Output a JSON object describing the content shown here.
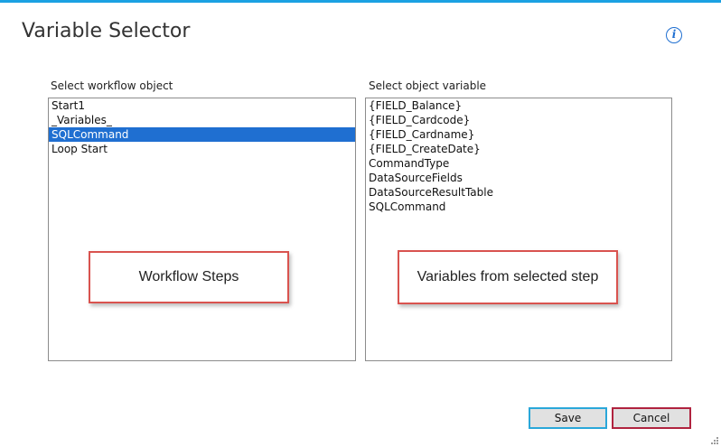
{
  "dialog": {
    "title": "Variable Selector",
    "info_icon": "info-icon",
    "accent_color": "#1ba1e2"
  },
  "left_panel": {
    "label": "Select workflow object",
    "items": [
      "Start1",
      "_Variables_",
      "SQLCommand",
      "Loop Start"
    ],
    "selected": "SQLCommand",
    "callout": "Workflow Steps"
  },
  "right_panel": {
    "label": "Select object variable",
    "items": [
      "{FIELD_Balance}",
      "{FIELD_Cardcode}",
      "{FIELD_Cardname}",
      "{FIELD_CreateDate}",
      "CommandType",
      "DataSourceFields",
      "DataSourceResultTable",
      "SQLCommand"
    ],
    "callout": "Variables from selected step"
  },
  "buttons": {
    "save_label": "Save",
    "cancel_label": "Cancel"
  },
  "colors": {
    "selection": "#1f6fd1",
    "callout_border": "#d9534f",
    "save_border": "#2aa7d9",
    "cancel_border": "#b0233f"
  }
}
